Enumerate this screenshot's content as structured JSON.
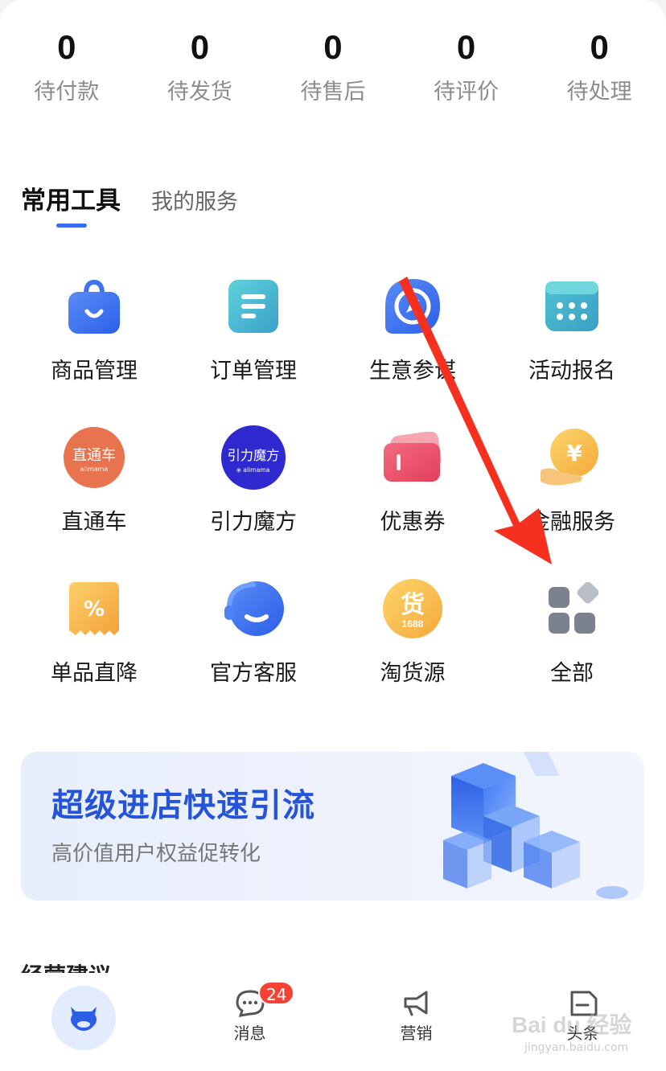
{
  "order_stats": [
    {
      "count": "0",
      "label": "待付款"
    },
    {
      "count": "0",
      "label": "待发货"
    },
    {
      "count": "0",
      "label": "待售后"
    },
    {
      "count": "0",
      "label": "待评价"
    },
    {
      "count": "0",
      "label": "待处理"
    }
  ],
  "tabs": {
    "active": "常用工具",
    "other": "我的服务"
  },
  "tools": [
    {
      "label": "商品管理",
      "icon": "shopping-bag-icon"
    },
    {
      "label": "订单管理",
      "icon": "order-list-icon"
    },
    {
      "label": "生意参谋",
      "icon": "compass-icon"
    },
    {
      "label": "活动报名",
      "icon": "calendar-icon"
    },
    {
      "label": "直通车",
      "icon": "ztc-logo",
      "logo_text": "直通车",
      "logo_sub": "alimama"
    },
    {
      "label": "引力魔方",
      "icon": "ylmf-logo",
      "logo_text": "引力魔方",
      "logo_sub": "alimama"
    },
    {
      "label": "优惠券",
      "icon": "coupon-icon"
    },
    {
      "label": "金融服务",
      "icon": "yen-coin-icon",
      "coin_symbol": "¥"
    },
    {
      "label": "单品直降",
      "icon": "discount-ticket-icon"
    },
    {
      "label": "官方客服",
      "icon": "customer-service-icon"
    },
    {
      "label": "淘货源",
      "icon": "huo-1688-logo",
      "logo_text": "货",
      "logo_sub": "1688"
    },
    {
      "label": "全部",
      "icon": "all-apps-icon"
    }
  ],
  "banner": {
    "title": "超级进店快速引流",
    "subtitle": "高价值用户权益促转化"
  },
  "section_peek": "经营建议",
  "bottom_nav": [
    {
      "label": "",
      "icon": "niu-home-icon"
    },
    {
      "label": "消息",
      "icon": "message-icon",
      "badge": "24"
    },
    {
      "label": "营销",
      "icon": "megaphone-icon"
    },
    {
      "label": "头条",
      "icon": "news-icon"
    }
  ],
  "watermark": {
    "text": "Bai du 经验",
    "url": "jingyan.baidu.com"
  },
  "colors": {
    "accent": "#3b6cf6",
    "banner_title": "#2553d9",
    "annotation_arrow": "#f5301e",
    "badge": "#f44336"
  }
}
